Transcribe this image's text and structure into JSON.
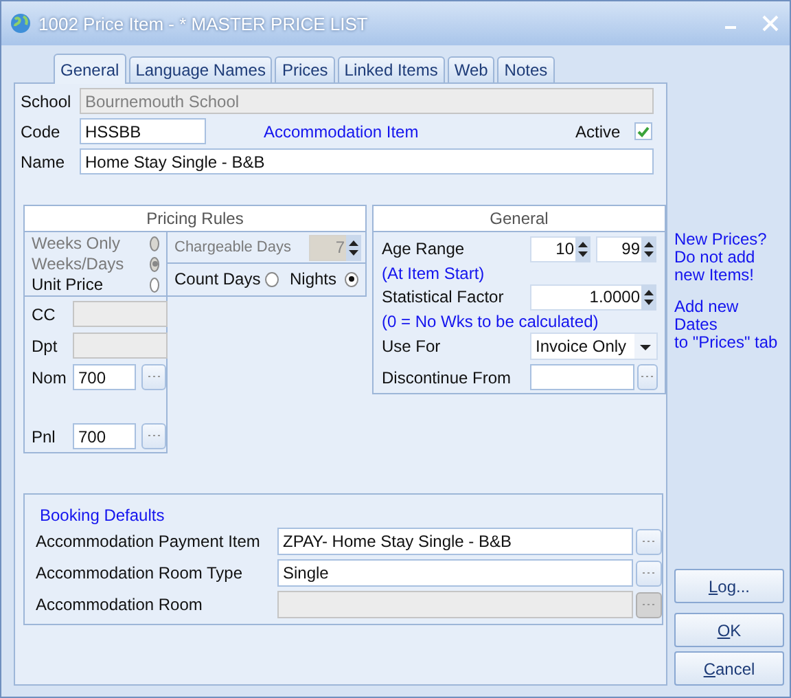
{
  "window": {
    "title": "1002 Price Item - * MASTER PRICE LIST"
  },
  "tabs": [
    {
      "label": "General",
      "selected": true
    },
    {
      "label": "Language Names",
      "selected": false
    },
    {
      "label": "Prices",
      "selected": false
    },
    {
      "label": "Linked Items",
      "selected": false
    },
    {
      "label": "Web",
      "selected": false
    },
    {
      "label": "Notes",
      "selected": false
    }
  ],
  "header": {
    "school": {
      "label": "School",
      "value": "Bournemouth School",
      "disabled": true
    },
    "code": {
      "label": "Code",
      "value": "HSSBB"
    },
    "item_type": "Accommodation Item",
    "active": {
      "label": "Active",
      "checked": true
    },
    "name": {
      "label": "Name",
      "value": "Home Stay Single - B&B"
    }
  },
  "pricing_rules": {
    "title": "Pricing Rules",
    "options": [
      {
        "label": "Weeks Only",
        "selected": false,
        "disabled": true
      },
      {
        "label": "Weeks/Days",
        "selected": true,
        "disabled": true
      },
      {
        "label": "Unit Price",
        "selected": false,
        "disabled": false
      }
    ],
    "chargeable_days": {
      "label": "Chargeable Days",
      "value": "7",
      "disabled": true
    },
    "count_days": [
      {
        "label": "Count Days",
        "selected": false
      },
      {
        "label": "Nights",
        "selected": true
      }
    ],
    "accounts": [
      {
        "label": "CC",
        "disabled": true,
        "browse": false
      },
      {
        "label": "Dpt",
        "disabled": true,
        "browse": false
      },
      {
        "label": "Nom",
        "value": "700",
        "disabled": false,
        "browse": true
      },
      {
        "label": "Pnl",
        "value": "700",
        "disabled": false,
        "browse": true
      }
    ]
  },
  "general": {
    "title": "General",
    "age_range": {
      "label": "Age Range",
      "from": "10",
      "to": "99"
    },
    "age_note": "(At Item Start)",
    "factor": {
      "label": "Statistical Factor",
      "value": "1.0000"
    },
    "factor_note": "(0 = No  Wks to be calculated)",
    "use_for": {
      "label": "Use For",
      "value": "Invoice Only"
    },
    "discontinue_from": {
      "label": "Discontinue From"
    }
  },
  "booking_defaults": {
    "title": "Booking Defaults",
    "fields": [
      {
        "label": "Accommodation Payment Item",
        "value": "ZPAY- Home Stay Single - B&B",
        "disabled": false
      },
      {
        "label": "Accommodation Room Type",
        "value": "Single",
        "disabled": false
      },
      {
        "label": "Accommodation Room",
        "disabled": true
      }
    ]
  },
  "side_notes": [
    "New Prices?\nDo not add\nnew Items!",
    "Add new Dates\nto \"Prices\" tab"
  ],
  "buttons": [
    "Log...",
    "OK",
    "Cancel"
  ]
}
